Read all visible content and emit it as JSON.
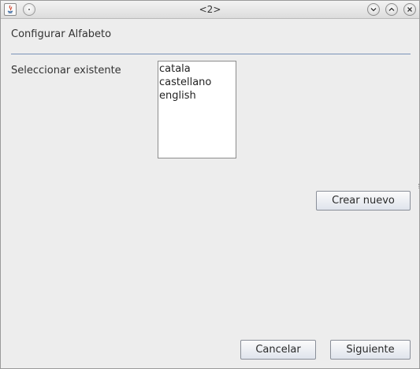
{
  "window": {
    "title": "<2>",
    "controls": [
      "minimize-icon",
      "maximize-icon",
      "close-icon"
    ]
  },
  "heading": "Configurar Alfabeto",
  "select_existing": {
    "label": "Seleccionar existente",
    "items": [
      "catala",
      "castellano",
      "english"
    ]
  },
  "buttons": {
    "create_new": "Crear nuevo",
    "cancel": "Cancelar",
    "next": "Siguiente"
  },
  "colors": {
    "separator": "#7a93b8",
    "background": "#ededed"
  }
}
